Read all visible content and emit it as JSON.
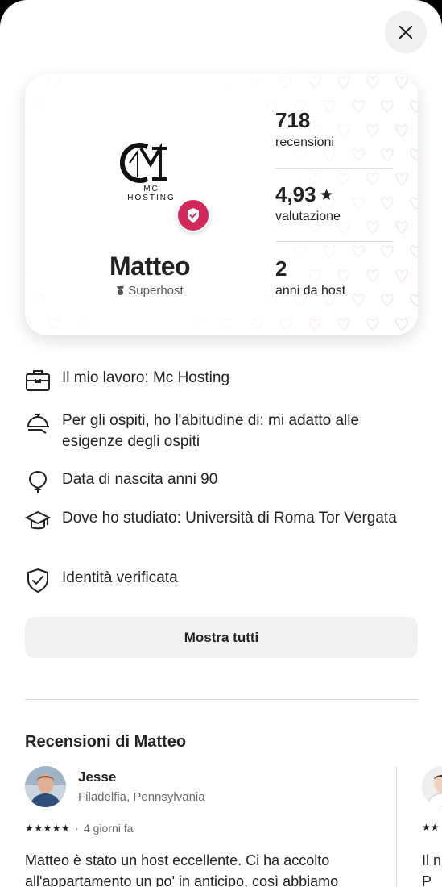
{
  "host": {
    "logo_text": "MC HOSTING",
    "name": "Matteo",
    "superhost_label": "Superhost",
    "stats": [
      {
        "value": "718",
        "label": "recensioni"
      },
      {
        "value": "4,93",
        "label": "valutazione",
        "star": true
      },
      {
        "value": "2",
        "label": "anni da host"
      }
    ]
  },
  "info_items": [
    {
      "icon": "briefcase-icon",
      "text": "Il mio lavoro: Mc Hosting"
    },
    {
      "icon": "cloche-icon",
      "text": "Per gli ospiti, ho l'abitudine di: mi adatto alle esigenze degli ospiti"
    },
    {
      "icon": "balloon-icon",
      "text": "Data di nascita anni 90"
    },
    {
      "icon": "graduation-cap-icon",
      "text": "Dove ho studiato: Università di Roma Tor Vergata"
    },
    {
      "icon": "verified-shield-icon",
      "text": "Identità verificata"
    }
  ],
  "show_all_label": "Mostra tutti",
  "reviews": {
    "title": "Recensioni di Matteo",
    "items": [
      {
        "name": "Jesse",
        "location": "Filadelfia, Pennsylvania",
        "stars": "★★★★★",
        "time": "4 giorni fa",
        "text": "Matteo è stato un host eccellente. Ci ha accolto all'appartamento un po' in anticipo, così abbiamo"
      }
    ],
    "next_preview": {
      "stars": "★★",
      "text": "Il n\nP"
    }
  },
  "colors": {
    "accent": "#d4285a",
    "text": "#222222",
    "muted": "#6a6a6a"
  }
}
